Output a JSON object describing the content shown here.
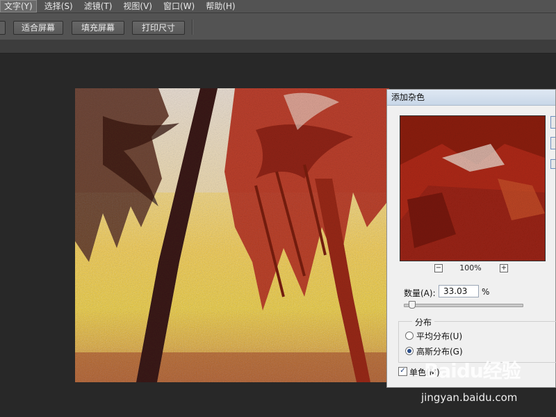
{
  "menubar": {
    "items": [
      {
        "label": "文字(Y)"
      },
      {
        "label": "选择(S)"
      },
      {
        "label": "滤镜(T)"
      },
      {
        "label": "视图(V)"
      },
      {
        "label": "窗口(W)"
      },
      {
        "label": "帮助(H)"
      }
    ]
  },
  "options_bar": {
    "fit_screen_label": "适合屏幕",
    "fill_screen_label": "填充屏幕",
    "print_size_label": "打印尺寸"
  },
  "dialog": {
    "title": "添加杂色",
    "zoom_minus": "−",
    "zoom_plus": "+",
    "zoom_level": "100%",
    "amount_label": "数量(A):",
    "amount_value": "33.03",
    "amount_unit": "%",
    "amount_slider_fraction": 0.07,
    "distribution_legend": "分布",
    "uniform_label": "平均分布(U)",
    "gaussian_label": "高斯分布(G)",
    "selected_distribution": "gaussian",
    "monochromatic_label": "单色(M)",
    "monochromatic_checked": true
  },
  "watermark": {
    "logo": "Baidu经验",
    "url": "jingyan.baidu.com"
  },
  "colors": {
    "ui_panel": "#535353",
    "workspace": "#282828",
    "dialog_bg": "#f0f0f0"
  }
}
